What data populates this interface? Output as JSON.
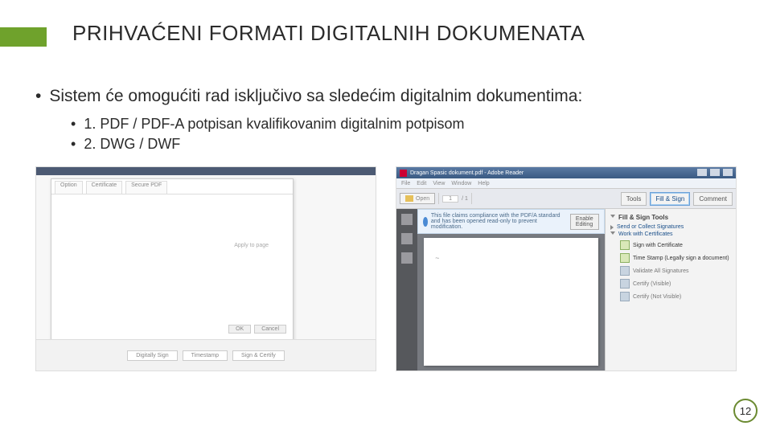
{
  "title": "PRIHVAĆENI FORMATI DIGITALNIH DOKUMENATA",
  "bullet_main": "Sistem će omogućiti rad isključivo sa sledećim digitalnim dokumentima:",
  "sub1": "1. PDF / PDF-A potpisan kvalifikovanim digitalnim potpisom",
  "sub2": "2. DWG / DWF",
  "left_mock": {
    "tabs": [
      "Option",
      "Certificate",
      "Secure PDF"
    ],
    "mid": "Apply to page",
    "ok": "OK",
    "cancel": "Cancel",
    "bbtn1": "Digitally Sign",
    "bbtn2": "Timestamp",
    "bbtn3": "Sign & Certify"
  },
  "adobe": {
    "title": "Dragan Spasic dokument.pdf - Adobe Reader",
    "menu": [
      "File",
      "Edit",
      "View",
      "Window",
      "Help"
    ],
    "open": "Open",
    "pagenum": "1",
    "pagecount": "/ 1",
    "tools": "Tools",
    "fillsign": "Fill & Sign",
    "comment": "Comment",
    "infomsg": "This file claims compliance with the PDF/A standard and has been opened read-only to prevent modification.",
    "enable": "Enable Editing",
    "side_hdr": "Fill & Sign Tools",
    "side_collect": "Send or Collect Signatures",
    "side_work": "Work with Certificates",
    "item_sign": "Sign with Certificate",
    "item_time": "Time Stamp (Legally sign a document)",
    "item_validate": "Validate All Signatures",
    "item_certv": "Certify (Visible)",
    "item_certnv": "Certify (Not Visible)"
  },
  "page_number": "12"
}
